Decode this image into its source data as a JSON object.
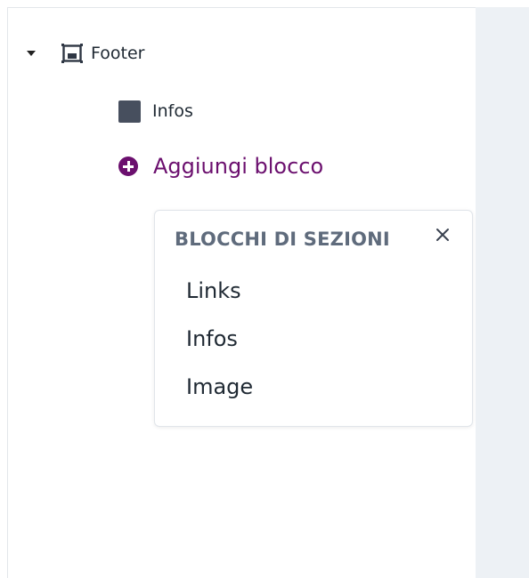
{
  "tree": {
    "section": {
      "label": "Footer",
      "icon": "section-frame-icon"
    },
    "blocks": [
      {
        "label": "Infos",
        "icon": "square-block-icon"
      }
    ],
    "add_block": {
      "label": "Aggiungi blocco",
      "icon": "plus-circle-icon",
      "color": "#6b0f6e"
    }
  },
  "popover": {
    "title": "BLOCCHI DI SEZIONI",
    "close_icon": "close-icon",
    "items": [
      {
        "label": "Links"
      },
      {
        "label": "Infos"
      },
      {
        "label": "Image"
      }
    ]
  },
  "colors": {
    "accent": "#6b0f6e",
    "text": "#1f2933",
    "muted_title": "#5f6b7c",
    "right_pane_bg": "#edf1f5"
  }
}
